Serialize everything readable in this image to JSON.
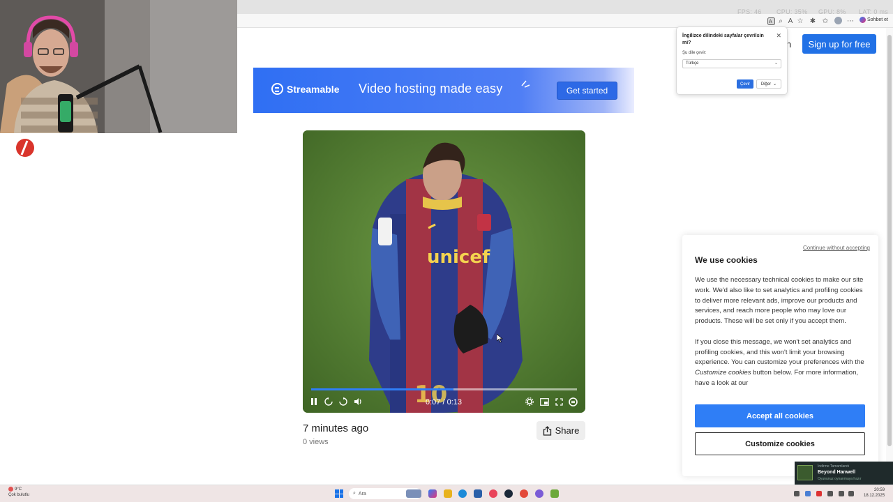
{
  "browser": {
    "perf_overlay": [
      "FPS: 46",
      "CPU: 35%",
      "GPU: 8%",
      "LAT: 0 ms"
    ],
    "chat_button_label": "Sohbet et"
  },
  "header": {
    "login_fragment": "in",
    "signup_label": "Sign up for free"
  },
  "banner": {
    "brand": "Streamable",
    "headline": "Video hosting made easy",
    "cta_label": "Get started"
  },
  "translate_popup": {
    "title": "İngilizce dilindeki sayfalar çevrilsin mi?",
    "language_label": "Şu dile çevir:",
    "selected_language": "Türkçe",
    "translate_label": "Çevir",
    "other_label": "Diğer"
  },
  "player": {
    "time_display": "0:07 / 0:13",
    "progress_fraction": 0.535,
    "buffered_fraction": 0.54
  },
  "video_meta": {
    "posted": "7 minutes ago",
    "views": "0 views",
    "share_label": "Share"
  },
  "cookie_banner": {
    "continue_label": "Continue without accepting",
    "title": "We use cookies",
    "para1": "We use the necessary technical cookies to make our site work. We'd also like to set analytics and profiling cookies to deliver more relevant ads, improve our products and services, and reach more people who may love our products. These will be set only if you accept them.",
    "para2_before": "If you close this message, we won't set analytics and profiling cookies, and this won't limit your browsing experience. You can customize your preferences with the ",
    "para2_italic": "Customize cookies",
    "para2_after": " button below. For more information, have a look at our",
    "accept_label": "Accept all cookies",
    "customize_label": "Customize cookies"
  },
  "taskbar": {
    "weather_temp": "9°C",
    "weather_desc": "Çok bulutlu",
    "search_placeholder": "Ara",
    "time": "20:59",
    "date": "18.12.2025"
  },
  "notification": {
    "line1": "İndirme Tamamlandı",
    "line2": "Beyond Hanwell",
    "line3": "Oyununuz oynanmaya hazır"
  },
  "colors": {
    "accent": "#2f7ef6",
    "signup_blue": "#2171e6"
  }
}
